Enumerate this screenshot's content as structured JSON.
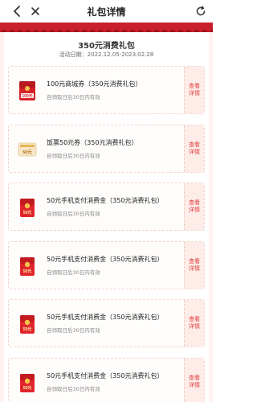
{
  "header": {
    "title": "礼包详情",
    "back_icon": "chevron-left-icon",
    "close_icon": "close-icon",
    "refresh_icon": "refresh-icon"
  },
  "package": {
    "title": "350元消费礼包",
    "date_label": "活动日期：2022.12.05-2023.02.28"
  },
  "colors": {
    "accent": "#e03b3b",
    "band": "#c8202b",
    "page_bg": "#fff2f0"
  },
  "cards": [
    {
      "name": "100元商城券（350元消费礼包）",
      "valid": "自领取日后30日内有效",
      "thumb": "red-packet-100",
      "thumb_text": "100元",
      "action": "查看详情"
    },
    {
      "name": "饭票50元券（350元消费礼包）",
      "valid": "自领取日后30日内有效",
      "thumb": "meal-ticket",
      "thumb_text": "50元",
      "action": "查看详情"
    },
    {
      "name": "50元手机支付消费金（350元消费礼包）",
      "valid": "自领取日后30日内有效",
      "thumb": "red-envelope-50",
      "thumb_text": "50元",
      "action": "查看详情"
    },
    {
      "name": "50元手机支付消费金（350元消费礼包）",
      "valid": "自领取日后30日内有效",
      "thumb": "red-envelope-50",
      "thumb_text": "50元",
      "action": "查看详情"
    },
    {
      "name": "50元手机支付消费金（350元消费礼包）",
      "valid": "自领取日后30日内有效",
      "thumb": "red-envelope-50",
      "thumb_text": "50元",
      "action": "查看详情"
    },
    {
      "name": "50元手机支付消费金（350元消费礼包）",
      "valid": "自领取日后30日内有效",
      "thumb": "red-envelope-50",
      "thumb_text": "50元",
      "action": "查看详情"
    }
  ]
}
